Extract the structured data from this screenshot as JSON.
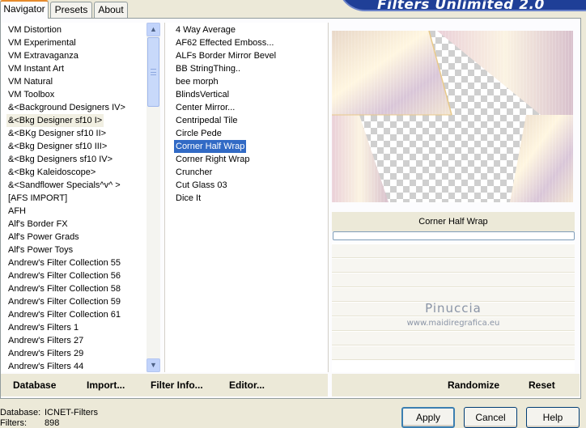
{
  "window": {
    "brand": "Filters Unlimited 2.0"
  },
  "tabs": [
    {
      "label": "Navigator",
      "active": true
    },
    {
      "label": "Presets",
      "active": false
    },
    {
      "label": "About",
      "active": false
    }
  ],
  "categories": {
    "selected": "&<Bkg Designer sf10 I>",
    "items": [
      "VM Distortion",
      "VM Experimental",
      "VM Extravaganza",
      "VM Instant Art",
      "VM Natural",
      "VM Toolbox",
      "&<Background Designers IV>",
      "&<Bkg Designer sf10 I>",
      "&<BKg Designer sf10 II>",
      "&<Bkg Designer sf10 III>",
      "&<Bkg Designers sf10 IV>",
      "&<Bkg Kaleidoscope>",
      "&<Sandflower Specials^v^ >",
      "[AFS IMPORT]",
      "AFH",
      "Alf's Border FX",
      "Alf's Power Grads",
      "Alf's Power Toys",
      "Andrew's Filter Collection 55",
      "Andrew's Filter Collection 56",
      "Andrew's Filter Collection 58",
      "Andrew's Filter Collection 59",
      "Andrew's Filter Collection 61",
      "Andrew's Filters 1",
      "Andrew's Filters 27",
      "Andrew's Filters 29",
      "Andrew's Filters 44"
    ]
  },
  "filters": {
    "selected": "Corner Half Wrap",
    "items": [
      "4 Way Average",
      "AF62 Effected Emboss...",
      "ALFs Border Mirror Bevel",
      "BB StringThing..",
      "bee morph",
      "BlindsVertical",
      "Center Mirror...",
      "Centripedal Tile",
      "Circle Pede",
      "Corner Half Wrap",
      "Corner Right Wrap",
      "Cruncher",
      "Cut Glass 03",
      "Dice It"
    ]
  },
  "preview": {
    "filter_name": "Corner Half Wrap",
    "progress": 0
  },
  "watermark": {
    "name": "Pinuccia",
    "url": "www.maidiregrafica.eu"
  },
  "actions": {
    "database": "Database",
    "import": "Import...",
    "filter_info": "Filter Info...",
    "editor": "Editor...",
    "randomize": "Randomize",
    "reset": "Reset"
  },
  "status": {
    "database_label": "Database:",
    "database_value": "ICNET-Filters",
    "filters_label": "Filters:",
    "filters_value": "898"
  },
  "buttons": {
    "apply": "Apply",
    "cancel": "Cancel",
    "help": "Help"
  },
  "colors": {
    "selection": "#316ac5",
    "brand_bg": "#1f3f97",
    "tab_accent": "#e68b2c"
  },
  "icons": {
    "scroll_up": "arrow-up-icon",
    "scroll_down": "arrow-down-icon"
  }
}
